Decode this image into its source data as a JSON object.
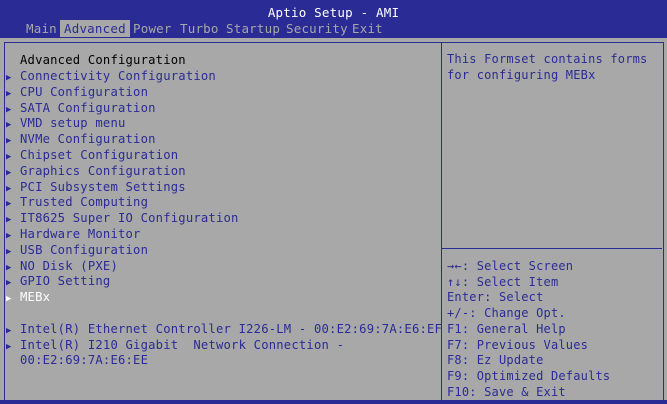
{
  "title": "Aptio Setup - AMI",
  "menu": [
    "Main",
    "Advanced",
    "Power",
    "Turbo",
    "Startup",
    "Security",
    "Exit"
  ],
  "heading": "Advanced Configuration",
  "items": [
    "Connectivity Configuration",
    "CPU Configuration",
    "SATA Configuration",
    "VMD setup menu",
    "NVMe Configuration",
    "Chipset Configuration",
    "Graphics Configuration",
    "PCI Subsystem Settings",
    "Trusted Computing",
    "IT8625 Super IO Configuration",
    "Hardware Monitor",
    "USB Configuration",
    "NO Disk (PXE)",
    "GPIO Setting",
    "MEBx"
  ],
  "network_items": [
    "Intel(R) Ethernet Controller I226-LM - 00:E2:69:7A:E6:EF",
    "Intel(R) I210 Gigabit  Network Connection -",
    "00:E2:69:7A:E6:EE"
  ],
  "help_text": "This Formset contains forms\nfor configuring MEBx",
  "keys": [
    "→←: Select Screen",
    "↑↓: Select Item",
    "Enter: Select",
    "+/-: Change Opt.",
    "F1: General Help",
    "F7: Previous Values",
    "F8: Ez Update",
    "F9: Optimized Defaults",
    "F10: Save & Exit"
  ],
  "colors": {
    "blue": "#2b2b96",
    "gray": "#a8a8a8",
    "white": "#ffffff"
  }
}
